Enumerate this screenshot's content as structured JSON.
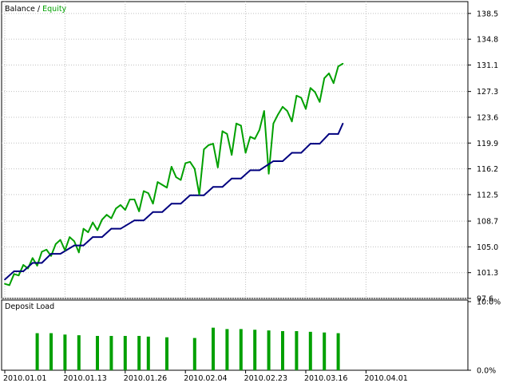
{
  "chart_data": [
    {
      "type": "line",
      "legend": {
        "balance_label": "Balance",
        "separator": " / ",
        "equity_label": "Equity"
      },
      "colors": {
        "balance": "#00007f",
        "equity": "#00a000",
        "grid": "#c0c0c0",
        "frame": "#000000"
      },
      "grid": true,
      "ylim": [
        97.6,
        140.2
      ],
      "y_ticks": [
        "138.5",
        "134.8",
        "131.1",
        "127.3",
        "123.6",
        "119.9",
        "116.2",
        "112.5",
        "108.7",
        "105.0",
        "101.3",
        "97.6"
      ],
      "y_tick_values": [
        138.5,
        134.8,
        131.1,
        127.3,
        123.6,
        119.9,
        116.2,
        112.5,
        108.7,
        105.0,
        101.3,
        97.6
      ],
      "x_index_range": [
        0,
        100
      ],
      "x": [
        0,
        2,
        4,
        6,
        8,
        10,
        12,
        15,
        17,
        19,
        21,
        23,
        25,
        28,
        30,
        32,
        34,
        36,
        38,
        40,
        43,
        45,
        47,
        49,
        51,
        53,
        55,
        58,
        60,
        62,
        64,
        66,
        68,
        70,
        72,
        73
      ],
      "series": [
        {
          "name": "Balance",
          "values": [
            100.3,
            101.5,
            101.5,
            102.7,
            102.7,
            104.0,
            104.0,
            105.2,
            105.2,
            106.4,
            106.4,
            107.6,
            107.6,
            108.8,
            108.8,
            110.0,
            110.0,
            111.2,
            111.2,
            112.4,
            112.4,
            113.6,
            113.6,
            114.8,
            114.8,
            116.0,
            116.0,
            117.3,
            117.3,
            118.5,
            118.5,
            119.8,
            119.8,
            121.2,
            121.2,
            122.7
          ]
        }
      ],
      "equity": {
        "name": "Equity",
        "x": [
          0,
          1,
          2,
          3,
          4,
          5,
          6,
          7,
          8,
          9,
          10,
          11,
          12,
          13,
          14,
          15,
          16,
          17,
          18,
          19,
          20,
          21,
          22,
          23,
          24,
          25,
          26,
          27,
          28,
          29,
          30,
          31,
          32,
          33,
          34,
          35,
          36,
          37,
          38,
          39,
          40,
          41,
          42,
          43,
          44,
          45,
          46,
          47,
          48,
          49,
          50,
          51,
          52,
          53,
          54,
          55,
          56,
          57,
          58,
          59,
          60,
          61,
          62,
          63,
          64,
          65,
          66,
          67,
          68,
          69,
          70,
          71,
          72,
          73
        ],
        "values": [
          99.7,
          99.5,
          101.1,
          100.9,
          102.4,
          101.9,
          103.4,
          102.3,
          104.3,
          104.6,
          103.7,
          105.4,
          106.0,
          104.5,
          106.4,
          105.8,
          104.2,
          107.6,
          107.1,
          108.5,
          107.4,
          108.9,
          109.6,
          109.1,
          110.5,
          111.0,
          110.3,
          111.8,
          111.8,
          110.1,
          113.0,
          112.7,
          111.2,
          114.3,
          113.9,
          113.5,
          116.5,
          115.0,
          114.6,
          117.0,
          117.2,
          116.2,
          112.5,
          119.0,
          119.6,
          119.8,
          116.4,
          121.6,
          121.2,
          118.2,
          122.7,
          122.4,
          118.5,
          120.8,
          120.5,
          121.8,
          124.5,
          115.5,
          122.7,
          124.0,
          125.1,
          124.5,
          123.0,
          126.7,
          126.4,
          124.8,
          127.8,
          127.2,
          125.8,
          129.2,
          129.9,
          128.5,
          130.9,
          131.3
        ]
      },
      "x_tick_labels": [
        "2010.01.01",
        "2010.01.13",
        "2010.01.26",
        "2010.02.04",
        "2010.02.23",
        "2010.03.16",
        "2010.04.01"
      ],
      "x_tick_positions": [
        0,
        13,
        26,
        39,
        52,
        65,
        78
      ]
    },
    {
      "type": "bar",
      "title": "Deposit Load",
      "colors": {
        "bar": "#00a000"
      },
      "ylim": [
        0,
        10
      ],
      "y_ticks": [
        "10.0%",
        "0.0%"
      ],
      "y_tick_values": [
        10,
        0
      ],
      "x": [
        7,
        10,
        13,
        16,
        20,
        23,
        26,
        29,
        31,
        35,
        41,
        45,
        48,
        51,
        54,
        57,
        60,
        63,
        66,
        69,
        72
      ],
      "values": [
        5.4,
        5.4,
        5.2,
        5.1,
        5.0,
        5.0,
        5.0,
        5.0,
        4.9,
        4.8,
        4.7,
        6.2,
        6.0,
        6.0,
        5.9,
        5.8,
        5.7,
        5.7,
        5.6,
        5.5,
        5.4
      ]
    }
  ]
}
